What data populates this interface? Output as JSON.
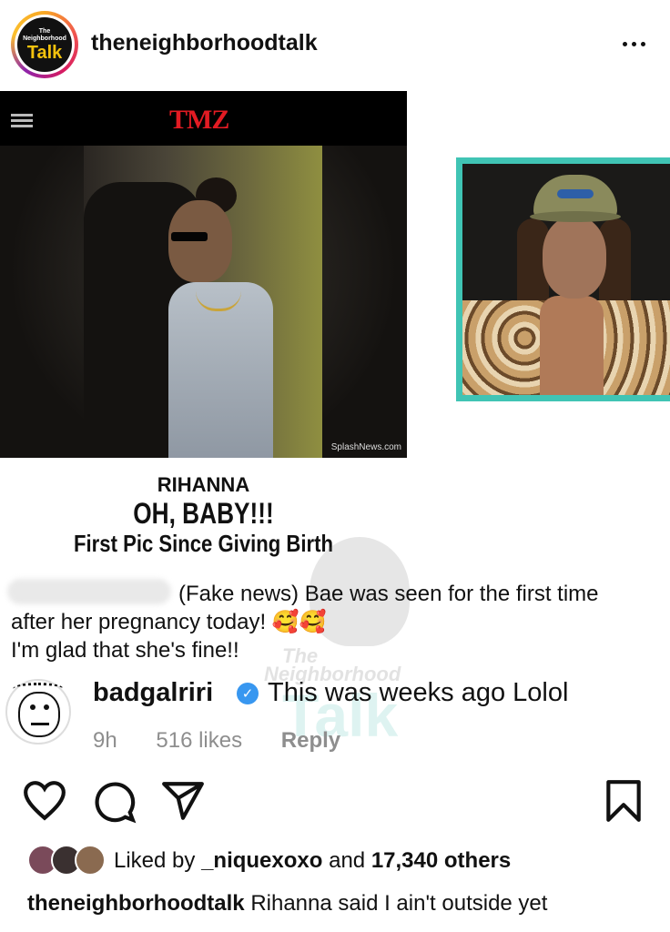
{
  "header": {
    "avatar_small_text": "The Neighborhood",
    "avatar_big_text": "Talk",
    "username": "theneighborhoodtalk",
    "more_icon": "more-horizontal-icon"
  },
  "media": {
    "tmz_logo": "TMZ",
    "photo_credit": "SplashNews.com",
    "headline_name": "RIHANNA",
    "headline_main": "OH, BABY!!!",
    "headline_sub": "First Pic Since Giving Birth",
    "caption_line1": "(Fake news) Bae was seen for the first time",
    "caption_line2": "after her pregnancy today! 🥰🥰",
    "caption_line3": "I'm glad that she's fine!!",
    "watermark_top": "The",
    "watermark_mid": "Neighborhood",
    "watermark_big": "Talk",
    "comment": {
      "username": "badgalriri",
      "verified_icon": "verified-badge-icon",
      "text": "This was weeks ago Lolol",
      "time": "9h",
      "likes": "516 likes",
      "reply_label": "Reply"
    },
    "accent_color": "#40c4b4"
  },
  "actions": {
    "like_icon": "heart-icon",
    "comment_icon": "comment-icon",
    "share_icon": "send-icon",
    "save_icon": "bookmark-icon"
  },
  "likes": {
    "prefix": "Liked by ",
    "user": "_niquexoxo",
    "middle": " and ",
    "count": "17,340 others"
  },
  "caption": {
    "username": "theneighborhoodtalk",
    "text": " Rihanna said I ain't outside yet"
  }
}
